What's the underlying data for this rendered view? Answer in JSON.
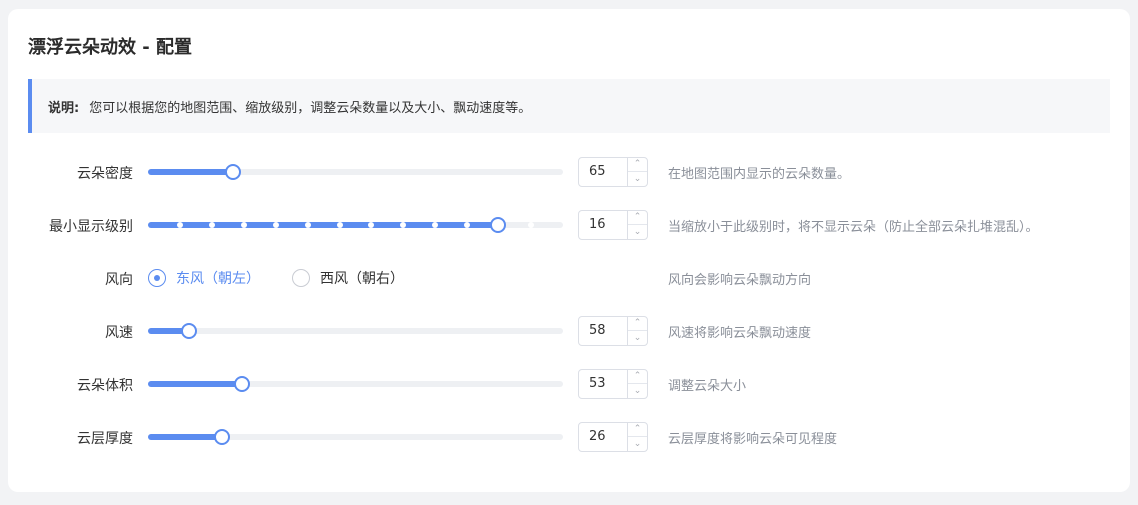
{
  "title": "漂浮云朵动效 - 配置",
  "notice": {
    "label": "说明:",
    "text": "您可以根据您的地图范围、缩放级别，调整云朵数量以及大小、飘动速度等。"
  },
  "accent_color": "#5b8cf0",
  "rows": [
    {
      "label": "云朵密度",
      "value": "65",
      "fill_fraction": 0.205,
      "hint": "在地图范围内显示的云朵数量。"
    },
    {
      "label": "最小显示级别",
      "value": "16",
      "fill_fraction": 0.843,
      "hint": "当缩放小于此级别时，将不显示云朵（防止全部云朵扎堆混乱）。"
    },
    {
      "label": "风速",
      "value": "58",
      "fill_fraction": 0.099,
      "hint": "风速将影响云朵飘动速度"
    },
    {
      "label": "云朵体积",
      "value": "53",
      "fill_fraction": 0.226,
      "hint": "调整云朵大小"
    },
    {
      "label": "云层厚度",
      "value": "26",
      "fill_fraction": 0.178,
      "hint": "云层厚度将影响云朵可见程度"
    }
  ],
  "wind": {
    "label": "风向",
    "options": [
      "东风（朝左）",
      "西风（朝右）"
    ],
    "selected": "东风（朝左）",
    "hint": "风向会影响云朵飘动方向"
  },
  "icons": {
    "up": "chevron-up-icon",
    "down": "chevron-down-icon"
  }
}
